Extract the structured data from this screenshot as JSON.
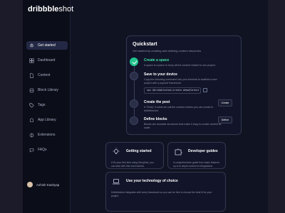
{
  "brand": {
    "name_bold": "dribbble",
    "name_light": "shot"
  },
  "sidebar": {
    "items": [
      {
        "label": "Get started",
        "icon": "rocket-icon",
        "active": true
      },
      {
        "label": "Dashboard",
        "icon": "dashboard-icon",
        "active": false
      },
      {
        "label": "Content",
        "icon": "content-icon",
        "active": false
      },
      {
        "label": "Block Library",
        "icon": "block-library-icon",
        "active": false
      },
      {
        "label": "Tags",
        "icon": "tag-icon",
        "active": false
      },
      {
        "label": "App Library",
        "icon": "app-library-icon",
        "active": false
      },
      {
        "label": "Extensions",
        "icon": "extensions-icon",
        "active": false
      },
      {
        "label": "FAQs",
        "icon": "faq-icon",
        "active": false
      }
    ],
    "user": {
      "name": "Ashish Kashyap"
    }
  },
  "quickstart": {
    "title": "Quickstart",
    "subtitle": "Get started by creating and defining content structures",
    "steps": [
      {
        "title": "Create a space",
        "desc": "A space is a place to keep all the content related to one project.",
        "done": true
      },
      {
        "title": "Save to your device",
        "desc": "Copy the following command into your terminal to scaffold a new project with a popular framework.",
        "command": "npx @dribbbleshot/create-demo@latest -key eu...",
        "done": false
      },
      {
        "title": "Create the post",
        "desc": "A \"Entry\" is what we call the content entries you can create in dribbbleshot.",
        "button": "Create",
        "done": false
      },
      {
        "title": "Define blocks",
        "desc": "Blocks are reusable structures that make it easy to create content at scale.",
        "button": "Define",
        "done": false
      }
    ]
  },
  "cards": [
    {
      "title": "Getting started",
      "desc": "If it's your first time using Storyblok, you can start with this short tutorial.",
      "icon": "lightbulb-icon"
    },
    {
      "title": "Developer guides",
      "desc": "A comprehensive guide from basic features up to in-depth content to integrations.",
      "icon": "puzzle-icon"
    }
  ],
  "tech_card": {
    "title": "Use your technology of choice",
    "desc": "Dribbbleshot integrates with every framework so you can be free to choose the best fit for your project.",
    "icon": "laptop-icon"
  },
  "colors": {
    "accent": "#23c48e",
    "background": "#101322",
    "sidebar": "#0b0d18"
  }
}
